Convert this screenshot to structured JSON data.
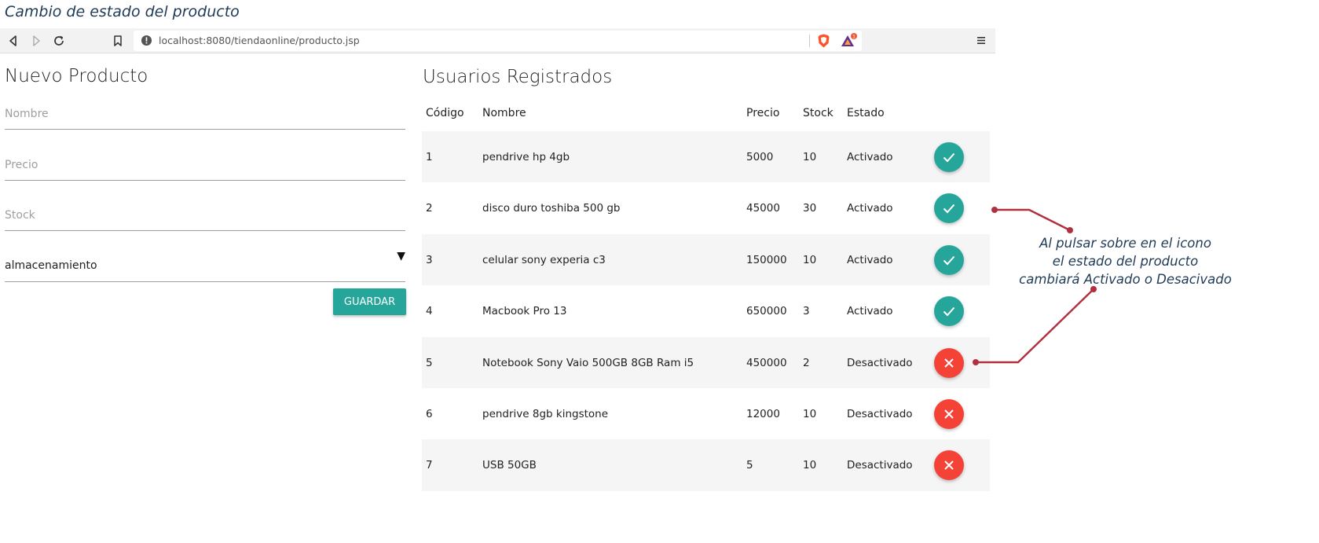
{
  "caption": "Cambio de estado del producto",
  "browser": {
    "url": "localhost:8080/tiendaonline/producto.jsp",
    "rewards_badge": "1"
  },
  "form": {
    "title": "Nuevo Producto",
    "nombre_placeholder": "Nombre",
    "precio_placeholder": "Precio",
    "stock_placeholder": "Stock",
    "categoria_value": "almacenamiento",
    "save_label": "GUARDAR"
  },
  "table": {
    "title": "Usuarios Registrados",
    "headers": {
      "codigo": "Código",
      "nombre": "Nombre",
      "precio": "Precio",
      "stock": "Stock",
      "estado": "Estado"
    },
    "rows": [
      {
        "codigo": "1",
        "nombre": "pendrive hp 4gb",
        "precio": "5000",
        "stock": "10",
        "estado": "Activado",
        "icon": "check-icon"
      },
      {
        "codigo": "2",
        "nombre": "disco duro toshiba 500 gb",
        "precio": "45000",
        "stock": "30",
        "estado": "Activado",
        "icon": "check-icon"
      },
      {
        "codigo": "3",
        "nombre": "celular sony experia c3",
        "precio": "150000",
        "stock": "10",
        "estado": "Activado",
        "icon": "check-icon"
      },
      {
        "codigo": "4",
        "nombre": "Macbook Pro 13",
        "precio": "650000",
        "stock": "3",
        "estado": "Activado",
        "icon": "check-icon"
      },
      {
        "codigo": "5",
        "nombre": "Notebook Sony Vaio 500GB 8GB Ram i5",
        "precio": "450000",
        "stock": "2",
        "estado": "Desactivado",
        "icon": "close-icon"
      },
      {
        "codigo": "6",
        "nombre": "pendrive 8gb kingstone",
        "precio": "12000",
        "stock": "10",
        "estado": "Desactivado",
        "icon": "close-icon"
      },
      {
        "codigo": "7",
        "nombre": "USB 50GB",
        "precio": "5",
        "stock": "10",
        "estado": "Desactivado",
        "icon": "close-icon"
      }
    ]
  },
  "annotation": {
    "line1": "Al pulsar sobre en el icono",
    "line2": "el estado del producto",
    "line3": "cambiará Activado o Desacivado"
  },
  "colors": {
    "activated": "#26a69a",
    "deactivated": "#f44336",
    "annotation_line": "#b0303f"
  }
}
